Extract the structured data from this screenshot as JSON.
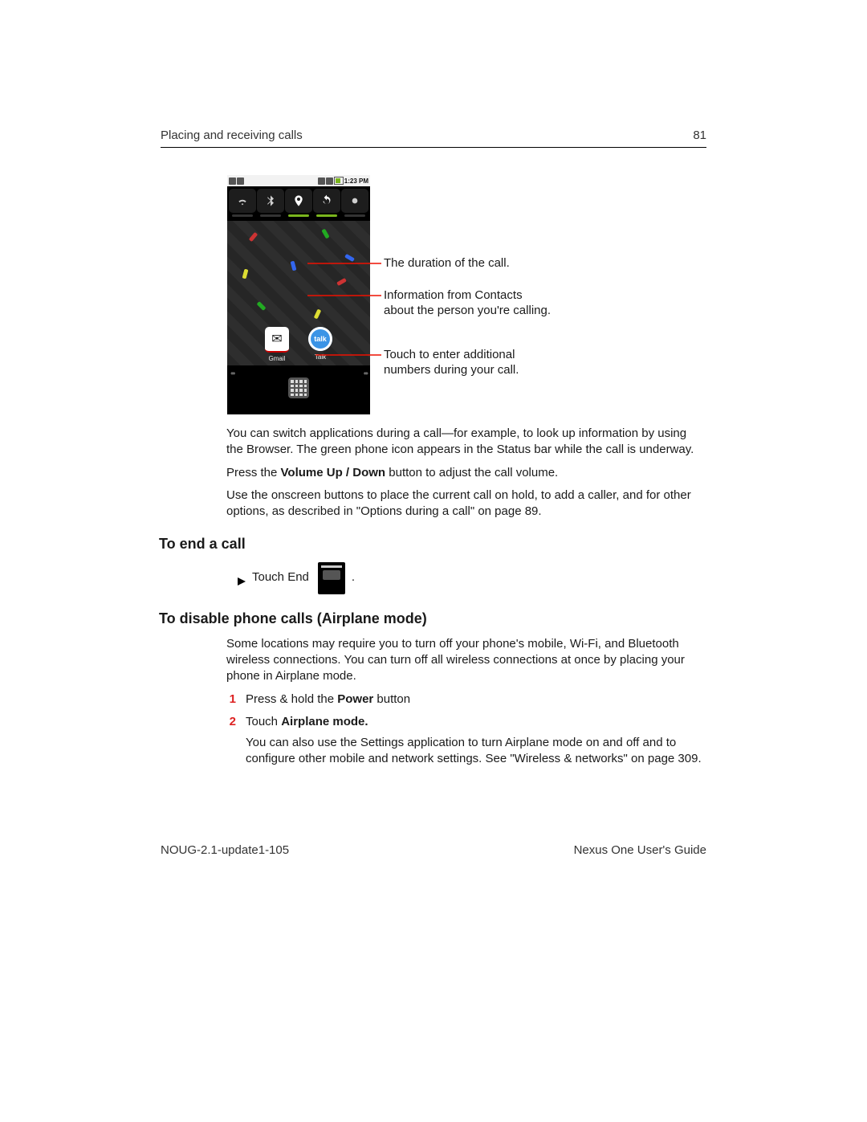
{
  "header": {
    "section": "Placing and receiving calls",
    "page": "81"
  },
  "footer": {
    "left": "NOUG-2.1-update1-105",
    "right": "Nexus One User's Guide"
  },
  "phone": {
    "status_time": "1:23 PM",
    "apps": [
      {
        "name": "Gmail",
        "label": "Gmail"
      },
      {
        "name": "Talk",
        "label": "Talk"
      }
    ]
  },
  "callouts": {
    "c1": "The duration of the call.",
    "c2": "Information from Contacts about the person you're calling.",
    "c3": "Touch to enter additional numbers during your call."
  },
  "body": {
    "p1": "You can switch applications during a call—for example, to look up information by using the Browser. The green phone icon appears in the Status bar while the call is underway.",
    "p2_pre": "Press the ",
    "p2_bold": "Volume Up / Down",
    "p2_post": " button to adjust the call volume.",
    "p3": "Use the onscreen buttons to place the current call on hold, to add a caller, and for other options, as described in \"Options during a call\" on page 89."
  },
  "sec1": {
    "title": "To end a call",
    "line": "Touch End",
    "period": "."
  },
  "sec2": {
    "title": "To disable phone calls (Airplane mode)",
    "intro": "Some locations may require you to turn off your phone's mobile, Wi-Fi, and Bluetooth wireless connections. You can turn off all wireless connections at once by placing your phone in Airplane mode.",
    "step1_num": "1",
    "step1_pre": "Press & hold the ",
    "step1_bold": "Power",
    "step1_post": " button",
    "step2_num": "2",
    "step2_pre": "Touch ",
    "step2_bold": "Airplane mode.",
    "step2_body": "You can also use the Settings application to turn Airplane mode on and off and to configure other mobile and network settings. See \"Wireless & networks\" on page 309."
  }
}
